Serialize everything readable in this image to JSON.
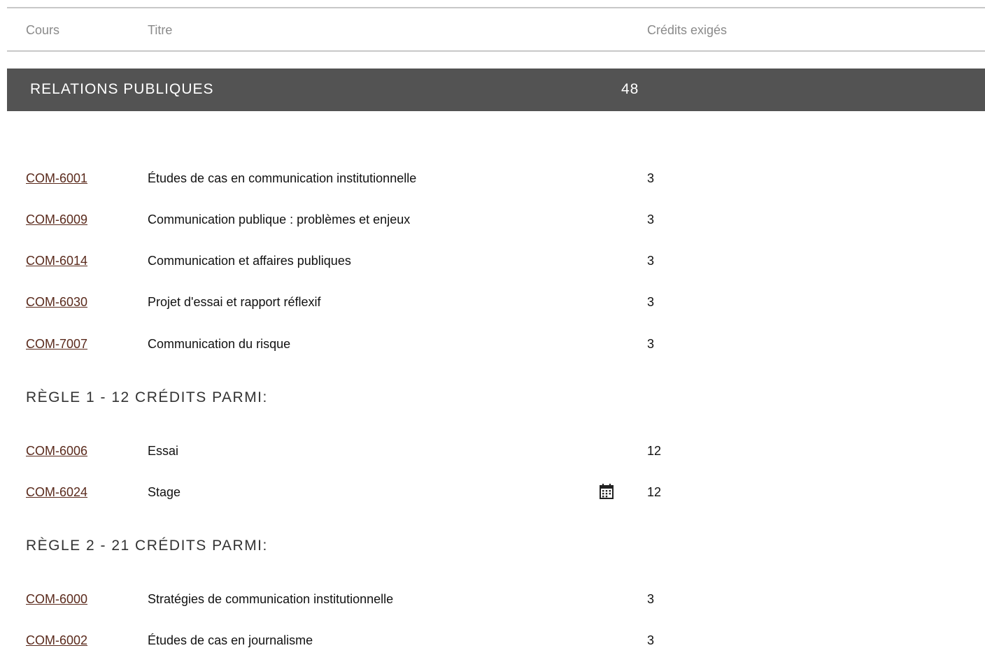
{
  "header": {
    "col_cours": "Cours",
    "col_titre": "Titre",
    "col_credits": "Crédits exigés"
  },
  "section": {
    "title": "RELATIONS PUBLIQUES",
    "credits": "48"
  },
  "required_courses": [
    {
      "code": "COM-6001",
      "title": "Études de cas en communication institutionnelle",
      "credits": "3"
    },
    {
      "code": "COM-6009",
      "title": "Communication publique : problèmes et enjeux",
      "credits": "3"
    },
    {
      "code": "COM-6014",
      "title": "Communication et affaires publiques",
      "credits": "3"
    },
    {
      "code": "COM-6030",
      "title": "Projet d'essai et rapport réflexif",
      "credits": "3"
    },
    {
      "code": "COM-7007",
      "title": "Communication du risque",
      "credits": "3"
    }
  ],
  "rule1": {
    "heading": "RÈGLE 1 - 12 CRÉDITS PARMI:",
    "courses": [
      {
        "code": "COM-6006",
        "title": "Essai",
        "credits": "12"
      },
      {
        "code": "COM-6024",
        "title": "Stage",
        "credits": "12",
        "icon": "calendar-icon"
      }
    ]
  },
  "rule2": {
    "heading": "RÈGLE 2 - 21 CRÉDITS PARMI:",
    "courses": [
      {
        "code": "COM-6000",
        "title": "Stratégies de communication institutionnelle",
        "credits": "3"
      },
      {
        "code": "COM-6002",
        "title": "Études de cas en journalisme",
        "credits": "3"
      }
    ]
  }
}
